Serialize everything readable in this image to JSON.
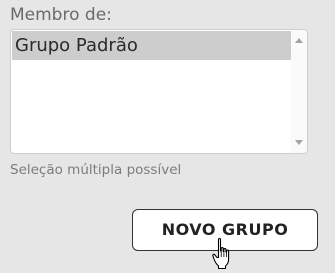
{
  "group_field": {
    "label": "Membro de:",
    "options": [
      "Grupo Padrão"
    ],
    "selected": "Grupo Padrão",
    "hint": "Seleção múltipla possível"
  },
  "actions": {
    "new_group_label": "NOVO GRUPO"
  },
  "cursor": {
    "icon": "hand-pointer-icon"
  }
}
